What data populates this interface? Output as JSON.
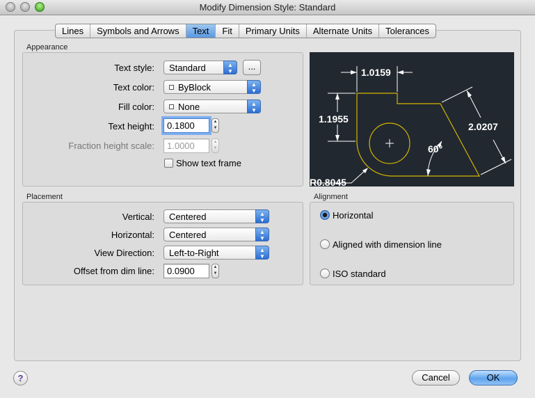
{
  "window": {
    "title": "Modify Dimension Style: Standard"
  },
  "tabs": [
    {
      "label": "Lines",
      "active": false
    },
    {
      "label": "Symbols and Arrows",
      "active": false
    },
    {
      "label": "Text",
      "active": true
    },
    {
      "label": "Fit",
      "active": false
    },
    {
      "label": "Primary Units",
      "active": false
    },
    {
      "label": "Alternate Units",
      "active": false
    },
    {
      "label": "Tolerances",
      "active": false
    }
  ],
  "appearance": {
    "title": "Appearance",
    "text_style": {
      "label": "Text style:",
      "value": "Standard",
      "browse_label": "..."
    },
    "text_color": {
      "label": "Text color:",
      "value": "ByBlock"
    },
    "fill_color": {
      "label": "Fill color:",
      "value": "None"
    },
    "text_height": {
      "label": "Text height:",
      "value": "0.1800"
    },
    "fraction_height_scale": {
      "label": "Fraction height scale:",
      "value": "1.0000"
    },
    "show_text_frame": {
      "label": "Show text frame",
      "checked": false
    }
  },
  "preview": {
    "dim_top": "1.0159",
    "dim_left": "1.1955",
    "dim_right": "2.0207",
    "angle": "60°",
    "radius": "R0.8045",
    "background": "#212830",
    "geometry_color": "#d6b600",
    "annotation_color": "#ffffff"
  },
  "placement": {
    "title": "Placement",
    "vertical": {
      "label": "Vertical:",
      "value": "Centered"
    },
    "horizontal": {
      "label": "Horizontal:",
      "value": "Centered"
    },
    "view_direction": {
      "label": "View Direction:",
      "value": "Left-to-Right"
    },
    "offset": {
      "label": "Offset from dim line:",
      "value": "0.0900"
    }
  },
  "alignment": {
    "title": "Alignment",
    "options": [
      {
        "label": "Horizontal",
        "checked": true
      },
      {
        "label": "Aligned with dimension line",
        "checked": false
      },
      {
        "label": "ISO standard",
        "checked": false
      }
    ]
  },
  "footer": {
    "help_label": "?",
    "cancel_label": "Cancel",
    "ok_label": "OK"
  }
}
